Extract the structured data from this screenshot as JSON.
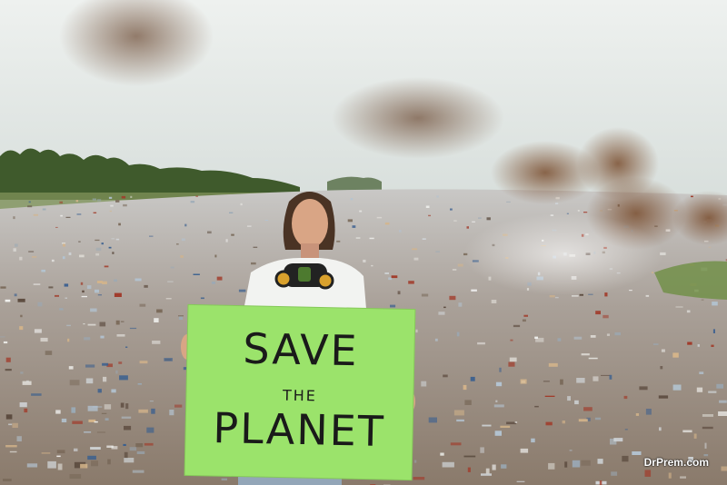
{
  "sign": {
    "line1": "SAVE",
    "line2": "THE",
    "line3": "PLANET",
    "color": "#9be36b"
  },
  "watermark": "DrPrem.com",
  "colors": {
    "sky": "#dfe5e3",
    "smoke": "#8a5a36",
    "trees": "#3f5a2c",
    "ground": "#9c8f80"
  }
}
